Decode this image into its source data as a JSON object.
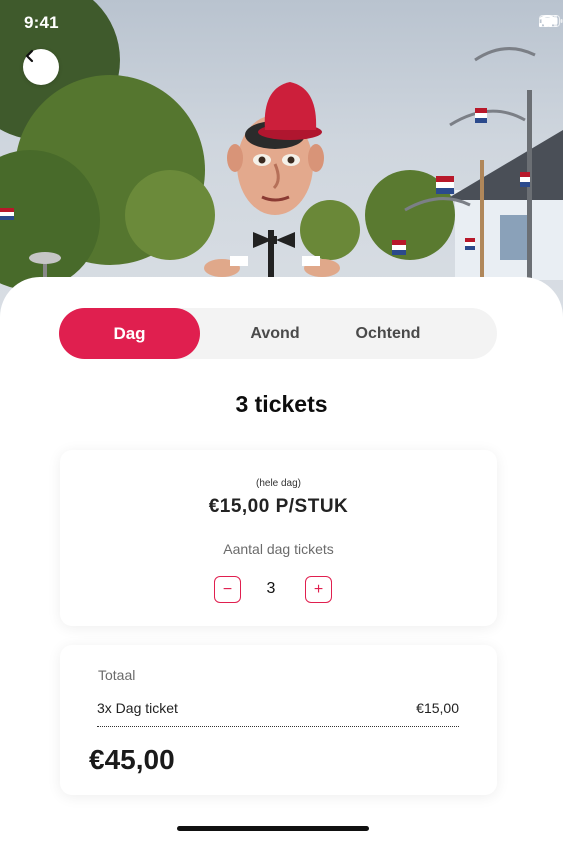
{
  "status_bar": {
    "time": "9:41"
  },
  "tabs": [
    {
      "label": "Dag",
      "active": true
    },
    {
      "label": "Avond",
      "active": false
    },
    {
      "label": "Ochtend",
      "active": false
    }
  ],
  "title": "3 tickets",
  "price_card": {
    "subtitle": "(hele dag)",
    "price": "€15,00 P/STUK",
    "quantity_label": "Aantal dag tickets",
    "quantity": "3",
    "minus": "−",
    "plus": "+"
  },
  "total_card": {
    "label": "Totaal",
    "line_name": "3x Dag ticket",
    "line_price": "€15,00",
    "total": "€45,00"
  },
  "colors": {
    "accent": "#e01f4f",
    "segment_bg": "#f3f3f3"
  },
  "icons": {
    "back": "chevron-left-icon",
    "signal": "signal-icon",
    "wifi": "wifi-icon",
    "battery": "battery-icon"
  }
}
